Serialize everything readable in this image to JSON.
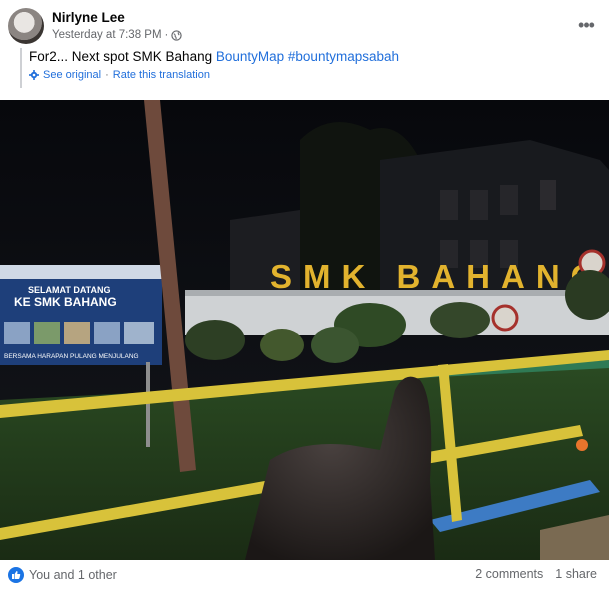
{
  "post": {
    "author": "Nirlyne Lee",
    "timestamp": "Yesterday at 7:38 PM",
    "privacy_icon": "globe-icon",
    "more_icon": "more-options-icon",
    "text_prefix": "For2... Next spot SMK Bahang ",
    "text_link": "BountyMap",
    "text_space": " ",
    "text_hashtag": "#bountymapsabah",
    "see_original": "See original",
    "separator": "·",
    "rate_translation": "Rate this translation"
  },
  "photo": {
    "sign_text": "SMK BAHANG",
    "banner_line1": "SELAMAT DATANG",
    "banner_line2": "KE SMK BAHANG",
    "banner_footer": "BERSAMA HARAPAN PULANG MENJULANG"
  },
  "footer": {
    "reactions_text": "You and 1 other",
    "comments": "2 comments",
    "shares": "1 share",
    "like_icon": "like-icon",
    "like_color": "#1b74e4"
  },
  "colors": {
    "link": "#216fdb",
    "meta": "#65676b",
    "sign_yellow": "#e2b32e",
    "rail_yellow": "#d8c23a"
  }
}
